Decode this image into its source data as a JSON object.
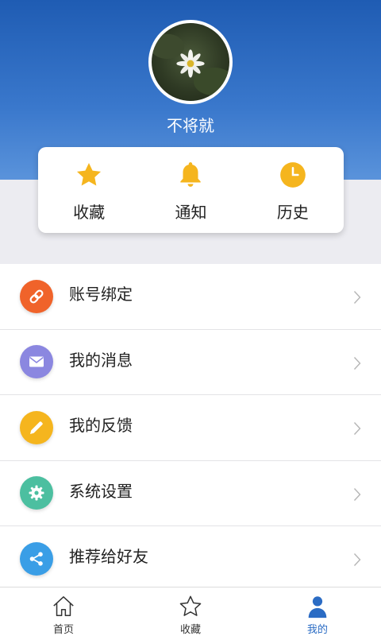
{
  "profile": {
    "username": "不将就"
  },
  "quick_actions": [
    {
      "label": "收藏",
      "icon": "star-icon",
      "color": "#f5b51e"
    },
    {
      "label": "通知",
      "icon": "bell-icon",
      "color": "#f5b51e"
    },
    {
      "label": "历史",
      "icon": "clock-icon",
      "color": "#f5b51e"
    }
  ],
  "menu": [
    {
      "label": "账号绑定",
      "icon": "link-icon",
      "color": "#f0632a"
    },
    {
      "label": "我的消息",
      "icon": "envelope-icon",
      "color": "#8b87e0"
    },
    {
      "label": "我的反馈",
      "icon": "pencil-icon",
      "color": "#f5b51e"
    },
    {
      "label": "系统设置",
      "icon": "gear-icon",
      "color": "#4cbfa0"
    },
    {
      "label": "推荐给好友",
      "icon": "share-icon",
      "color": "#3a9ee6"
    }
  ],
  "tabbar": [
    {
      "label": "首页",
      "icon": "home-icon",
      "active": false
    },
    {
      "label": "收藏",
      "icon": "star-outline-icon",
      "active": false
    },
    {
      "label": "我的",
      "icon": "person-icon",
      "active": true
    }
  ],
  "colors": {
    "header_blue": "#1f5cb3",
    "accent_yellow": "#f5b51e",
    "active_tab": "#2b6cc4"
  }
}
